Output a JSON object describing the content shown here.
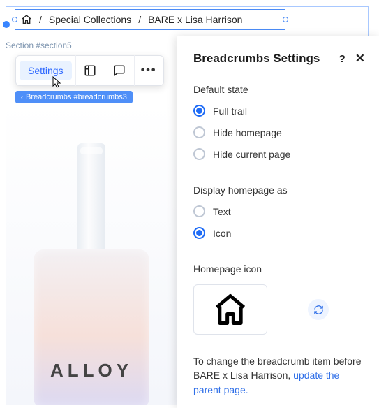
{
  "breadcrumb": {
    "items": [
      "Special Collections",
      "BARE x Lisa Harrison"
    ],
    "separator": "/"
  },
  "section_label": "Section #section5",
  "toolbar": {
    "settings_label": "Settings"
  },
  "tag_chip": "Breadcrumbs #breadcrumbs3",
  "product": {
    "brand_text": "ALLOY"
  },
  "panel": {
    "title": "Breadcrumbs Settings",
    "help": "?",
    "default_state": {
      "label": "Default state",
      "options": [
        "Full trail",
        "Hide homepage",
        "Hide current page"
      ],
      "selected": 0
    },
    "display_as": {
      "label": "Display homepage as",
      "options": [
        "Text",
        "Icon"
      ],
      "selected": 1
    },
    "homepage_icon_label": "Homepage icon",
    "note_before": "To change the breadcrumb item before BARE x Lisa Harrison, ",
    "note_link": "update the parent page.",
    "colors": {
      "accent": "#2f6fe8"
    }
  }
}
